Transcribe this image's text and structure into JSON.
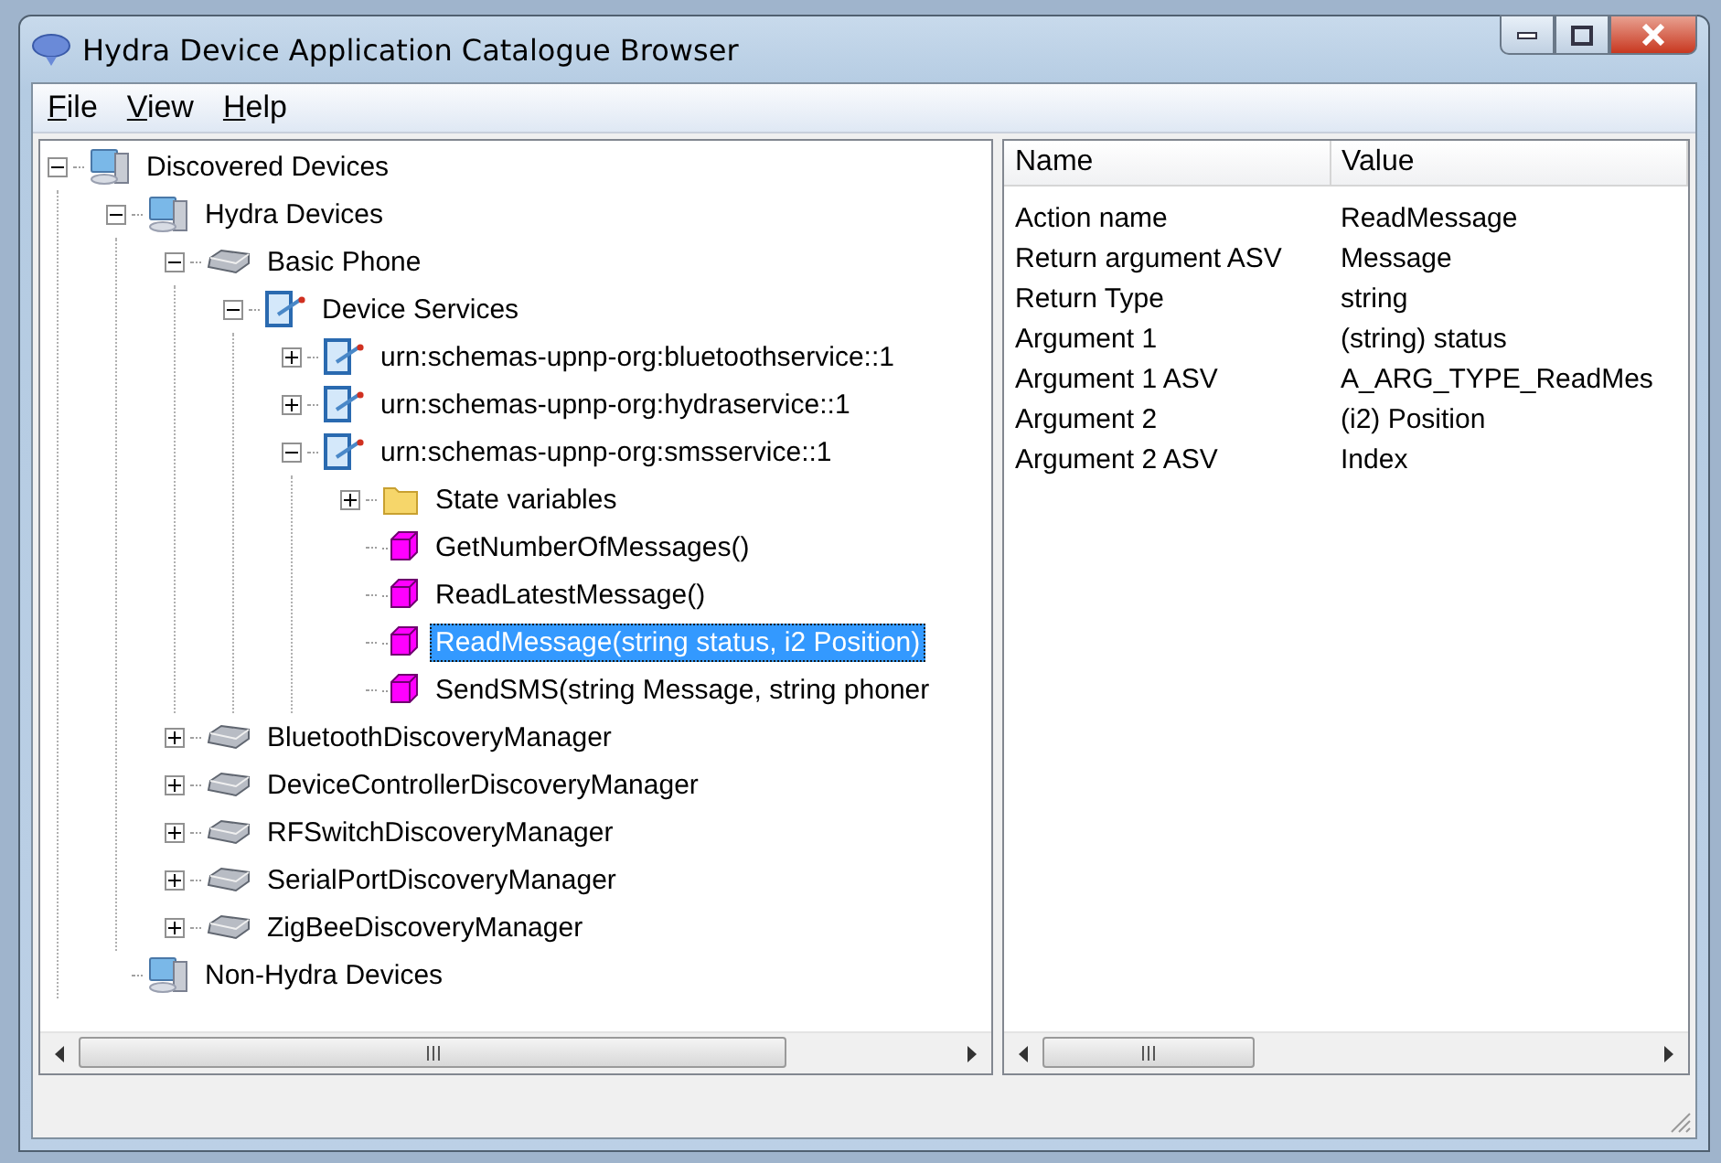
{
  "window": {
    "title": "Hydra Device Application Catalogue Browser"
  },
  "menu": [
    {
      "label": "File"
    },
    {
      "label": "View"
    },
    {
      "label": "Help"
    }
  ],
  "tree": [
    {
      "label": "Discovered Devices",
      "kind": "computer",
      "expanded": true,
      "selected": false,
      "children": [
        {
          "label": "Hydra Devices",
          "kind": "computer",
          "expanded": true,
          "selected": false,
          "children": [
            {
              "label": "Basic Phone",
              "kind": "device",
              "expanded": true,
              "selected": false,
              "children": [
                {
                  "label": "Device Services",
                  "kind": "service",
                  "expanded": true,
                  "selected": false,
                  "children": [
                    {
                      "label": "urn:schemas-upnp-org:bluetoothservice::1",
                      "kind": "service",
                      "expanded": false,
                      "selected": false
                    },
                    {
                      "label": "urn:schemas-upnp-org:hydraservice::1",
                      "kind": "service",
                      "expanded": false,
                      "selected": false
                    },
                    {
                      "label": "urn:schemas-upnp-org:smsservice::1",
                      "kind": "service",
                      "expanded": true,
                      "selected": false,
                      "children": [
                        {
                          "label": "State variables",
                          "kind": "folder",
                          "expanded": false,
                          "selected": false
                        },
                        {
                          "label": "GetNumberOfMessages()",
                          "kind": "method",
                          "selected": false
                        },
                        {
                          "label": "ReadLatestMessage()",
                          "kind": "method",
                          "selected": false
                        },
                        {
                          "label": "ReadMessage(string status, i2 Position)",
                          "kind": "method",
                          "selected": true
                        },
                        {
                          "label": "SendSMS(string Message, string phoner",
                          "kind": "method",
                          "selected": false
                        }
                      ]
                    }
                  ]
                }
              ]
            },
            {
              "label": "BluetoothDiscoveryManager",
              "kind": "device",
              "expanded": false,
              "selected": false
            },
            {
              "label": "DeviceControllerDiscoveryManager",
              "kind": "device",
              "expanded": false,
              "selected": false
            },
            {
              "label": "RFSwitchDiscoveryManager",
              "kind": "device",
              "expanded": false,
              "selected": false
            },
            {
              "label": "SerialPortDiscoveryManager",
              "kind": "device",
              "expanded": false,
              "selected": false
            },
            {
              "label": "ZigBeeDiscoveryManager",
              "kind": "device",
              "expanded": false,
              "selected": false
            }
          ]
        },
        {
          "label": "Non-Hydra Devices",
          "kind": "computer",
          "selected": false
        }
      ]
    }
  ],
  "table": {
    "columns": [
      "Name",
      "Value"
    ],
    "rows": [
      [
        "Action name",
        "ReadMessage"
      ],
      [
        "Return argument ASV",
        "Message"
      ],
      [
        "Return Type",
        "string"
      ],
      [
        "Argument 1",
        "(string) status"
      ],
      [
        "Argument 1 ASV",
        "A_ARG_TYPE_ReadMes"
      ],
      [
        "Argument 2",
        "(i2) Position"
      ],
      [
        "Argument 2 ASV",
        "Index"
      ]
    ]
  }
}
